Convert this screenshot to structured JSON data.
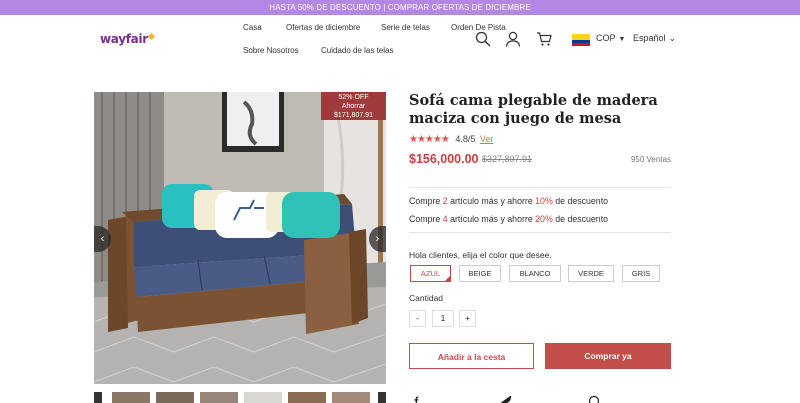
{
  "promo_bar": {
    "text": "HASTA 50% DE DESCUENTO | COMPRAR OFERTAS DE DICIEMBRE"
  },
  "header": {
    "logo": "wayfair",
    "nav": [
      "Casa",
      "Ofertas de diciembre",
      "Serie de telas",
      "Orden De Pista",
      "Sobre Nosotros",
      "Cuidado de las telas"
    ],
    "currency": "COP",
    "language": "Español",
    "flag_colors": [
      "#fcd116",
      "#003893",
      "#ce1126"
    ]
  },
  "gallery": {
    "badge": {
      "line1": "52% OFF",
      "line2": "Ahorrar",
      "line3": "$171,807.91"
    },
    "prev_icon": "‹",
    "next_icon": "›"
  },
  "product": {
    "title": "Sofá cama plegable de madera maciza con juego de mesa",
    "stars": "★★★★★",
    "rating": "4.8/5",
    "review_link": "Ver",
    "price": "$156,000.00",
    "old_price": "$327,807.91",
    "sales": "950 Ventas",
    "promos": [
      {
        "pre": "Compre ",
        "num": "2",
        "mid": " artículo más y ahorre ",
        "pct": "10%",
        "post": " de descuento"
      },
      {
        "pre": "Compre ",
        "num": "4",
        "mid": " artículo más y ahorre ",
        "pct": "20%",
        "post": " de descuento"
      }
    ],
    "color_label": "Hola clientes, elija el color que desee.",
    "colors": [
      "AZUL",
      "BEIGE",
      "BLANCO",
      "VERDE",
      "GRIS"
    ],
    "selected_color": "AZUL",
    "qty_label": "Cantidad",
    "qty_minus": "-",
    "qty_value": "1",
    "qty_plus": "+",
    "add_to_cart": "Añadir a la cesta",
    "buy_now": "Comprar ya"
  },
  "theme": {
    "accent": "#c24f4a",
    "promo_bg": "#b387e3"
  }
}
